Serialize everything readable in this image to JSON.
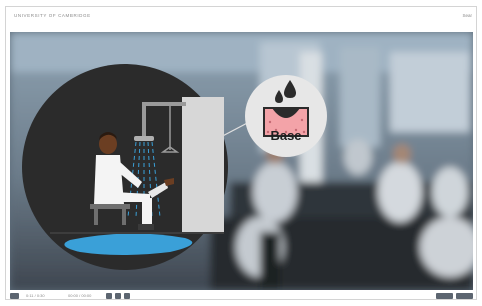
{
  "header": {
    "brand": "UNIVERSITY OF CAMBRIDGE",
    "right_text": "Sear"
  },
  "video": {
    "callout_label": "Base"
  },
  "controls": {
    "time_text": "0:11 / 0:30",
    "time_total_text": "00:00 / 00:00"
  },
  "colors": {
    "accent_circle": "#2b2b2b",
    "water": "#3aa0d8",
    "base_pink": "#f3a3a8",
    "callout_bg": "#e7e7e7"
  }
}
